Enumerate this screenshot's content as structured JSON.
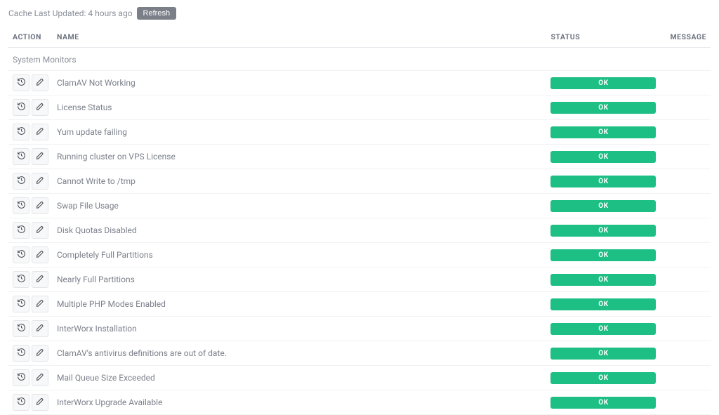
{
  "cache": {
    "last_updated_label": "Cache Last Updated: 4 hours ago",
    "refresh_label": "Refresh"
  },
  "headers": {
    "action": "ACTION",
    "name": "NAME",
    "status": "STATUS",
    "message": "MESSAGE"
  },
  "section_title": "System Monitors",
  "status_ok": "OK",
  "colors": {
    "ok_badge": "#1dbf84"
  },
  "items": [
    {
      "name": "ClamAV Not Working",
      "status": "OK",
      "message": ""
    },
    {
      "name": "License Status",
      "status": "OK",
      "message": ""
    },
    {
      "name": "Yum update failing",
      "status": "OK",
      "message": ""
    },
    {
      "name": "Running cluster on VPS License",
      "status": "OK",
      "message": ""
    },
    {
      "name": "Cannot Write to /tmp",
      "status": "OK",
      "message": ""
    },
    {
      "name": "Swap File Usage",
      "status": "OK",
      "message": ""
    },
    {
      "name": "Disk Quotas Disabled",
      "status": "OK",
      "message": ""
    },
    {
      "name": "Completely Full Partitions",
      "status": "OK",
      "message": ""
    },
    {
      "name": "Nearly Full Partitions",
      "status": "OK",
      "message": ""
    },
    {
      "name": "Multiple PHP Modes Enabled",
      "status": "OK",
      "message": ""
    },
    {
      "name": "InterWorx Installation",
      "status": "OK",
      "message": ""
    },
    {
      "name": "ClamAV's antivirus definitions are out of date.",
      "status": "OK",
      "message": ""
    },
    {
      "name": "Mail Queue Size Exceeded",
      "status": "OK",
      "message": ""
    },
    {
      "name": "InterWorx Upgrade Available",
      "status": "OK",
      "message": ""
    }
  ]
}
